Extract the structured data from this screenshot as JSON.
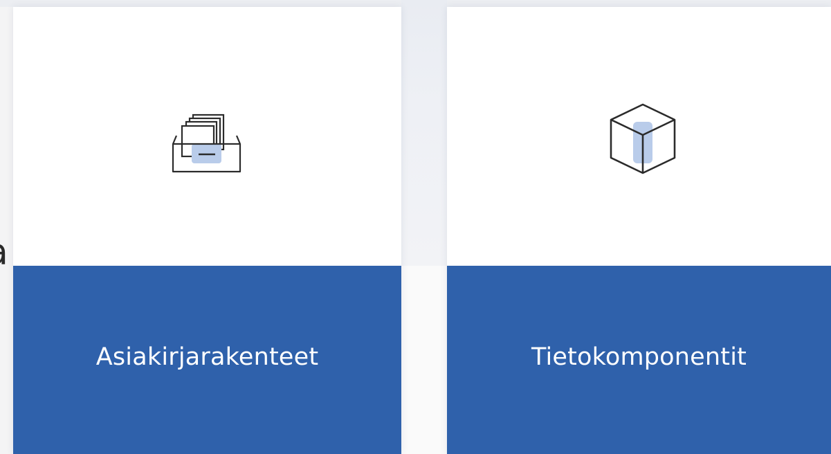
{
  "left_edge_text": "a",
  "cards": [
    {
      "label": "Asiakirjarakenteet",
      "icon": "document-drawer-icon"
    },
    {
      "label": "Tietokomponentit",
      "icon": "cube-icon"
    }
  ],
  "colors": {
    "card_bottom": "#2f61ab",
    "card_top": "#ffffff",
    "icon_stroke": "#2b2b2b",
    "icon_accent": "#b9ccea",
    "label_text": "#ffffff"
  }
}
